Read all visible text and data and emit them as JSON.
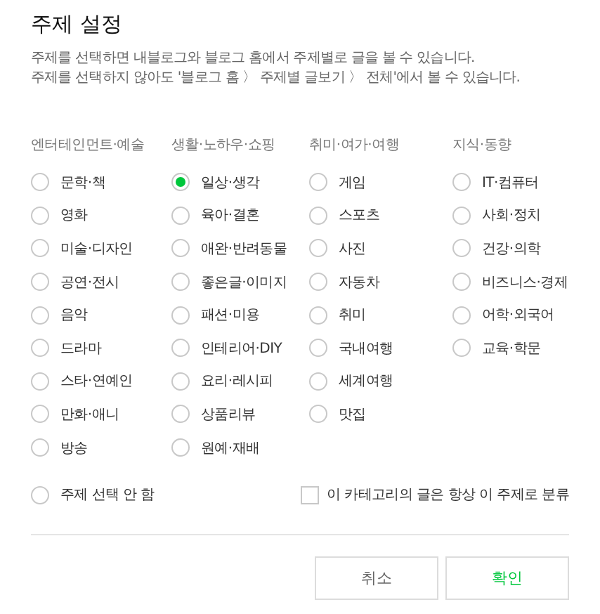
{
  "title": "주제 설정",
  "description": [
    "주제를 선택하면 내블로그와 블로그 홈에서 주제별로 글을 볼 수 있습니다.",
    "주제를 선택하지 않아도 '블로그 홈 〉 주제별 글보기 〉 전체'에서 볼 수 있습니다."
  ],
  "groups": [
    {
      "heading": "엔터테인먼트·예술",
      "options": [
        {
          "label": "문학·책",
          "selected": false
        },
        {
          "label": "영화",
          "selected": false
        },
        {
          "label": "미술·디자인",
          "selected": false
        },
        {
          "label": "공연·전시",
          "selected": false
        },
        {
          "label": "음악",
          "selected": false
        },
        {
          "label": "드라마",
          "selected": false
        },
        {
          "label": "스타·연예인",
          "selected": false
        },
        {
          "label": "만화·애니",
          "selected": false
        },
        {
          "label": "방송",
          "selected": false
        }
      ]
    },
    {
      "heading": "생활·노하우·쇼핑",
      "options": [
        {
          "label": "일상·생각",
          "selected": true
        },
        {
          "label": "육아·결혼",
          "selected": false
        },
        {
          "label": "애완·반려동물",
          "selected": false
        },
        {
          "label": "좋은글·이미지",
          "selected": false
        },
        {
          "label": "패션·미용",
          "selected": false
        },
        {
          "label": "인테리어·DIY",
          "selected": false
        },
        {
          "label": "요리·레시피",
          "selected": false
        },
        {
          "label": "상품리뷰",
          "selected": false
        },
        {
          "label": "원예·재배",
          "selected": false
        }
      ]
    },
    {
      "heading": "취미·여가·여행",
      "options": [
        {
          "label": "게임",
          "selected": false
        },
        {
          "label": "스포츠",
          "selected": false
        },
        {
          "label": "사진",
          "selected": false
        },
        {
          "label": "자동차",
          "selected": false
        },
        {
          "label": "취미",
          "selected": false
        },
        {
          "label": "국내여행",
          "selected": false
        },
        {
          "label": "세계여행",
          "selected": false
        },
        {
          "label": "맛집",
          "selected": false
        }
      ]
    },
    {
      "heading": "지식·동향",
      "options": [
        {
          "label": "IT·컴퓨터",
          "selected": false
        },
        {
          "label": "사회·정치",
          "selected": false
        },
        {
          "label": "건강·의학",
          "selected": false
        },
        {
          "label": "비즈니스·경제",
          "selected": false
        },
        {
          "label": "어학·외국어",
          "selected": false
        },
        {
          "label": "교육·학문",
          "selected": false
        }
      ]
    }
  ],
  "no_topic": {
    "label": "주제 선택 안 함",
    "selected": false
  },
  "always_category": {
    "label": "이 카테고리의 글은 항상 이 주제로 분류",
    "checked": false
  },
  "buttons": [
    {
      "label": "취소",
      "kind": "cancel"
    },
    {
      "label": "확인",
      "kind": "confirm"
    }
  ]
}
